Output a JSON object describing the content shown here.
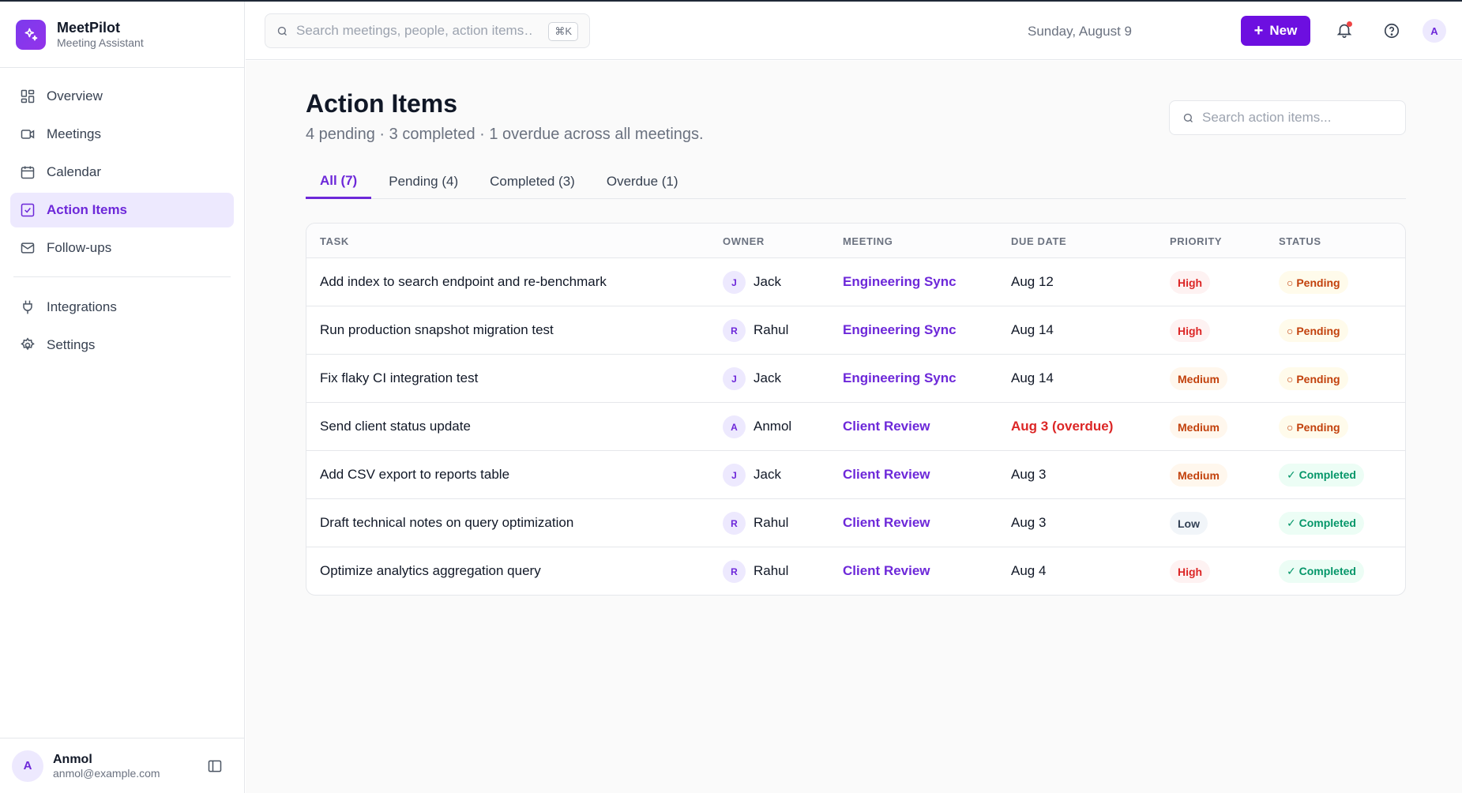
{
  "app": {
    "name": "MeetPilot",
    "subtitle": "Meeting Assistant"
  },
  "sidebar": {
    "items": [
      {
        "label": "Overview",
        "icon": "grid-icon"
      },
      {
        "label": "Meetings",
        "icon": "video-icon"
      },
      {
        "label": "Calendar",
        "icon": "calendar-icon"
      },
      {
        "label": "Action Items",
        "icon": "checkbox-icon",
        "active": true
      },
      {
        "label": "Follow-ups",
        "icon": "mail-icon"
      }
    ],
    "secondary": [
      {
        "label": "Integrations",
        "icon": "plug-icon"
      },
      {
        "label": "Settings",
        "icon": "gear-icon"
      }
    ],
    "user": {
      "initial": "A",
      "name": "Anmol",
      "email": "anmol@example.com"
    }
  },
  "topbar": {
    "search_placeholder": "Search meetings, people, action items…",
    "shortcut": "⌘K",
    "date": "Sunday, August 9",
    "new_label": "New",
    "avatar_initial": "A"
  },
  "page": {
    "title": "Action Items",
    "subtitle": "4 pending · 3 completed · 1 overdue across all meetings.",
    "filter_placeholder": "Search action items..."
  },
  "tabs": [
    {
      "label": "All (7)",
      "active": true
    },
    {
      "label": "Pending (4)"
    },
    {
      "label": "Completed (3)"
    },
    {
      "label": "Overdue (1)"
    }
  ],
  "table": {
    "headers": {
      "task": "TASK",
      "owner": "OWNER",
      "meeting": "MEETING",
      "due": "DUE DATE",
      "priority": "PRIORITY",
      "status": "STATUS"
    },
    "rows": [
      {
        "task": "Add index to search endpoint and re-benchmark",
        "owner_initial": "J",
        "owner": "Jack",
        "meeting": "Engineering Sync",
        "due": "Aug 12",
        "overdue": false,
        "priority": "High",
        "status": "○ Pending"
      },
      {
        "task": "Run production snapshot migration test",
        "owner_initial": "R",
        "owner": "Rahul",
        "meeting": "Engineering Sync",
        "due": "Aug 14",
        "overdue": false,
        "priority": "High",
        "status": "○ Pending"
      },
      {
        "task": "Fix flaky CI integration test",
        "owner_initial": "J",
        "owner": "Jack",
        "meeting": "Engineering Sync",
        "due": "Aug 14",
        "overdue": false,
        "priority": "Medium",
        "status": "○ Pending"
      },
      {
        "task": "Send client status update",
        "owner_initial": "A",
        "owner": "Anmol",
        "meeting": "Client Review",
        "due": "Aug 3 (overdue)",
        "overdue": true,
        "priority": "Medium",
        "status": "○ Pending"
      },
      {
        "task": "Add CSV export to reports table",
        "owner_initial": "J",
        "owner": "Jack",
        "meeting": "Client Review",
        "due": "Aug 3",
        "overdue": false,
        "priority": "Medium",
        "status": "✓ Completed"
      },
      {
        "task": "Draft technical notes on query optimization",
        "owner_initial": "R",
        "owner": "Rahul",
        "meeting": "Client Review",
        "due": "Aug 3",
        "overdue": false,
        "priority": "Low",
        "status": "✓ Completed"
      },
      {
        "task": "Optimize analytics aggregation query",
        "owner_initial": "R",
        "owner": "Rahul",
        "meeting": "Client Review",
        "due": "Aug 4",
        "overdue": false,
        "priority": "High",
        "status": "✓ Completed"
      }
    ]
  },
  "colors": {
    "accent": "#6d28d9",
    "button": "#6d0fe0",
    "overdue": "#dc2626",
    "completed": "#059669"
  }
}
